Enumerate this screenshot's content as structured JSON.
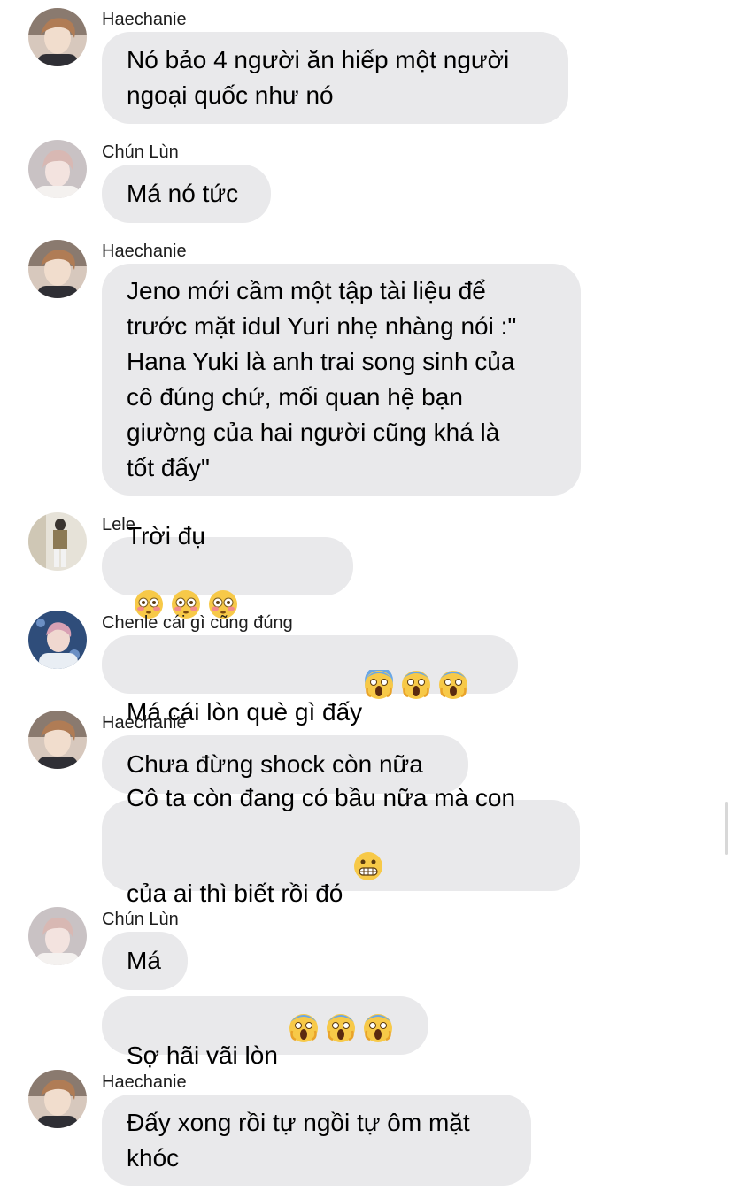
{
  "colors": {
    "bubble": "#e9e9eb",
    "background": "#ffffff",
    "text": "#000000"
  },
  "messages": [
    {
      "sender": "Haechanie",
      "avatar": "avatar-haechanie",
      "bubbles": [
        {
          "text": "Nó bảo 4 người ăn hiếp một người\nngoại quốc như nó",
          "emoji": []
        }
      ]
    },
    {
      "sender": "Chún Lùn",
      "avatar": "avatar-chun-lun",
      "bubbles": [
        {
          "text": "Má nó tức",
          "emoji": []
        }
      ]
    },
    {
      "sender": "Haechanie",
      "avatar": "avatar-haechanie",
      "bubbles": [
        {
          "text": "Jeno mới cầm một tập tài liệu để\ntrước mặt idul Yuri nhẹ nhàng nói :\"\nHana Yuki là anh trai song sinh của\ncô đúng chứ, mối quan hệ bạn\ngiường của hai người cũng khá là\ntốt đấy\"",
          "emoji": []
        }
      ]
    },
    {
      "sender": "Lele",
      "avatar": "avatar-lele",
      "bubbles": [
        {
          "text": "Trời đụ",
          "emoji": [
            "flushed-face-icon",
            "flushed-face-icon",
            "flushed-face-icon"
          ]
        }
      ]
    },
    {
      "sender": "Chenle cái gì cũng đúng",
      "avatar": "avatar-chenle",
      "bubbles": [
        {
          "text": "Má cái lòn què gì đấy",
          "emoji": [
            "screaming-face-icon",
            "screaming-face-icon",
            "screaming-face-icon"
          ]
        }
      ]
    },
    {
      "sender": "Haechanie",
      "avatar": "avatar-haechanie",
      "bubbles": [
        {
          "text": "Chưa đừng shock còn nữa",
          "emoji": []
        },
        {
          "text": "Cô ta còn đang có bầu nữa mà con\ncủa ai thì biết rồi đó",
          "emoji": [
            "grimacing-face-icon"
          ]
        }
      ]
    },
    {
      "sender": "Chún Lùn",
      "avatar": "avatar-chun-lun",
      "bubbles": [
        {
          "text": "Má",
          "emoji": []
        },
        {
          "text": "Sợ hãi vãi lòn",
          "emoji": [
            "screaming-face-icon",
            "screaming-face-icon",
            "screaming-face-icon"
          ]
        }
      ]
    },
    {
      "sender": "Haechanie",
      "avatar": "avatar-haechanie",
      "bubbles": [
        {
          "text": "Đấy xong rồi tự ngồi tự ôm mặt\nkhóc",
          "emoji": []
        }
      ]
    }
  ]
}
